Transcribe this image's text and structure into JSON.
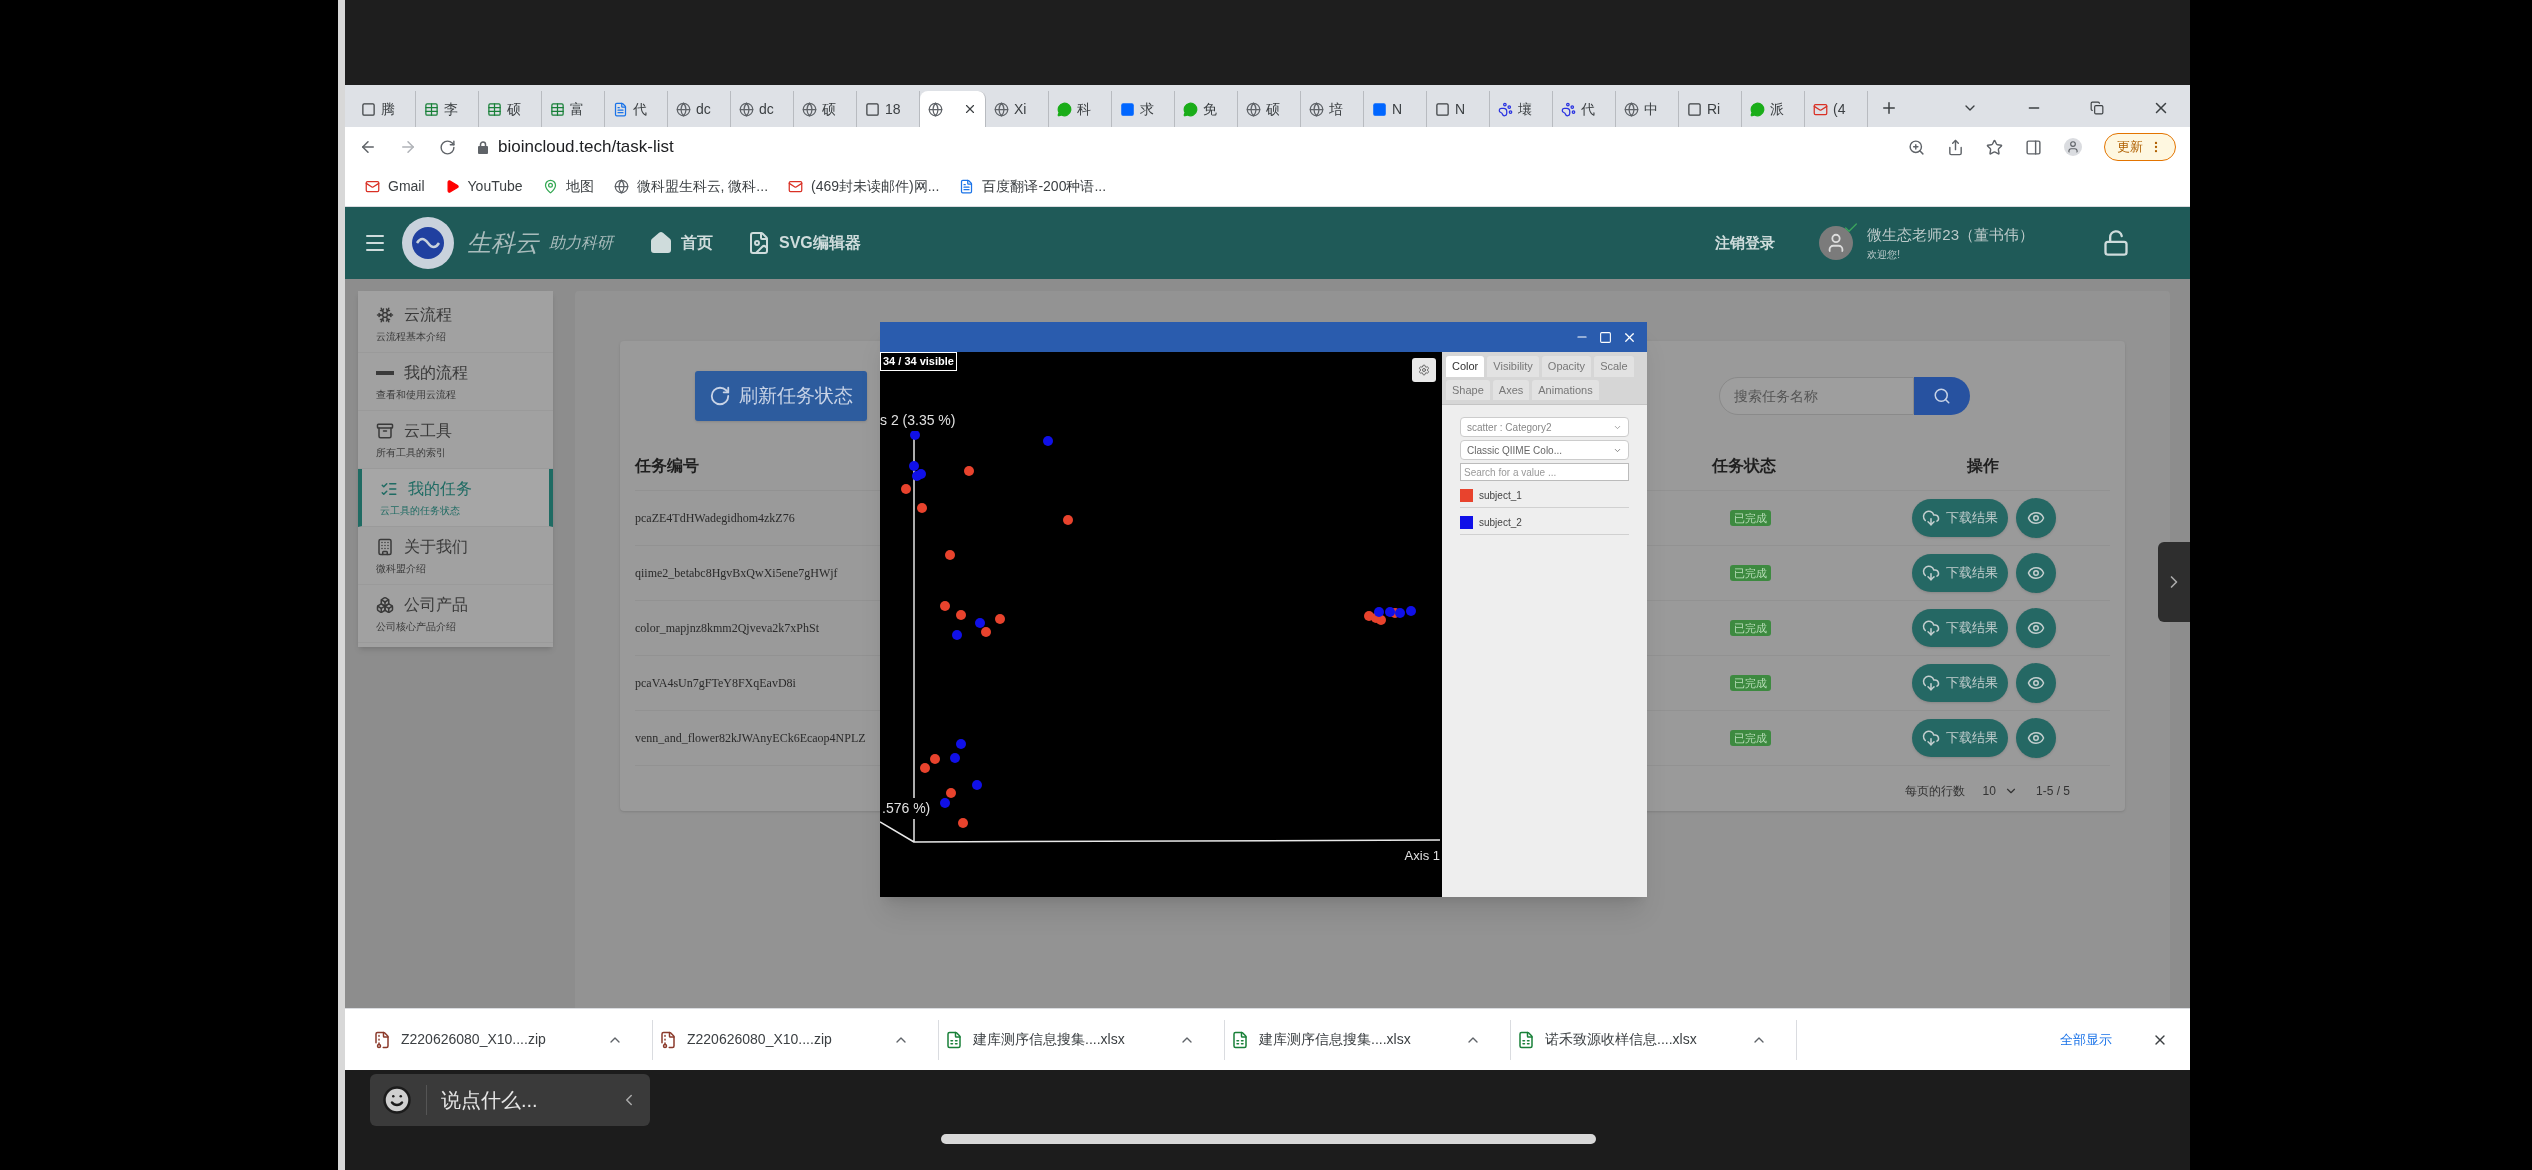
{
  "browser": {
    "tabs": [
      {
        "label": "腾",
        "kind": "other",
        "selected": false
      },
      {
        "label": "李",
        "kind": "sheet",
        "selected": false
      },
      {
        "label": "硕",
        "kind": "sheet",
        "selected": false
      },
      {
        "label": "富",
        "kind": "sheet",
        "selected": false
      },
      {
        "label": "代",
        "kind": "doc",
        "selected": false
      },
      {
        "label": "dc",
        "kind": "globe",
        "selected": false
      },
      {
        "label": "dc",
        "kind": "globe",
        "selected": false
      },
      {
        "label": "硕",
        "kind": "globe",
        "selected": false
      },
      {
        "label": "18",
        "kind": "other",
        "selected": false
      },
      {
        "kind": "globe",
        "selected": true
      },
      {
        "label": "Xi",
        "kind": "globe",
        "selected": false
      },
      {
        "label": "科",
        "kind": "chat",
        "selected": false
      },
      {
        "label": "求",
        "kind": "zhihu",
        "selected": false
      },
      {
        "label": "免",
        "kind": "chat",
        "selected": false
      },
      {
        "label": "硕",
        "kind": "globe",
        "selected": false
      },
      {
        "label": "培",
        "kind": "globe",
        "selected": false
      },
      {
        "label": "N",
        "kind": "zhihu",
        "selected": false
      },
      {
        "label": "N",
        "kind": "other",
        "selected": false
      },
      {
        "label": "壤",
        "kind": "paw",
        "selected": false
      },
      {
        "label": "代",
        "kind": "paw",
        "selected": false
      },
      {
        "label": "中",
        "kind": "globe",
        "selected": false
      },
      {
        "label": "Ri",
        "kind": "other",
        "selected": false
      },
      {
        "label": "派",
        "kind": "chat",
        "selected": false
      },
      {
        "label": "(4",
        "kind": "mail",
        "selected": false
      }
    ],
    "url": "bioincloud.tech/task-list",
    "update_button": "更新",
    "bookmarks": [
      {
        "label": "Gmail",
        "kind": "mail"
      },
      {
        "label": "YouTube",
        "kind": "video"
      },
      {
        "label": "地图",
        "kind": "map"
      },
      {
        "label": "微科盟生科云, 微科...",
        "kind": "globe"
      },
      {
        "label": "(469封未读邮件)网...",
        "kind": "mail"
      },
      {
        "label": "百度翻译-200种语...",
        "kind": "doc"
      }
    ]
  },
  "site": {
    "brand": "生科云",
    "slogan": "助力科研",
    "nav": [
      "首页",
      "SVG编辑器"
    ],
    "logout": "注销登录",
    "user_name": "微生态老师23（董书伟）",
    "user_greeting": "欢迎您!"
  },
  "sidebar": [
    {
      "title": "云流程",
      "subtitle": "云流程基本介绍",
      "selected": false
    },
    {
      "title": "我的流程",
      "subtitle": "查看和使用云流程",
      "selected": false
    },
    {
      "title": "云工具",
      "subtitle": "所有工具的索引",
      "selected": false
    },
    {
      "title": "我的任务",
      "subtitle": "云工具的任务状态",
      "selected": true
    },
    {
      "title": "关于我们",
      "subtitle": "微科盟介绍",
      "selected": false
    },
    {
      "title": "公司产品",
      "subtitle": "公司核心产品介绍",
      "selected": false
    }
  ],
  "refresh_button": "刷新任务状态",
  "search": {
    "placeholder": "搜索任务名称"
  },
  "table": {
    "columns": [
      "任务编号",
      "任务状态",
      "操作"
    ],
    "rows": [
      {
        "id": "pcaZE4TdHWadegidhom4zkZ76",
        "status": "已完成",
        "action": "下载结果"
      },
      {
        "id": "qiime2_betabc8HgvBxQwXi5ene7gHWjf",
        "status": "已完成",
        "action": "下载结果"
      },
      {
        "id": "color_mapjnz8kmm2Qjveva2k7xPhSt",
        "status": "已完成",
        "action": "下载结果"
      },
      {
        "id": "pcaVA4sUn7gFTeY8FXqEavD8i",
        "status": "已完成",
        "action": "下载结果"
      },
      {
        "id": "venn_and_flower82kJWAnyECk6Ecaop4NPLZ",
        "status": "已完成",
        "action": "下载结果"
      }
    ]
  },
  "pagination": {
    "label": "每页的行数",
    "per_page": "10",
    "range": "1-5 / 5"
  },
  "dialog": {
    "visible_count": "34 / 34 visible",
    "axis_labels": [
      "s 2 (3.35 %)",
      ".576 %)",
      "Axis 1"
    ],
    "tabs": [
      {
        "label": "Color",
        "selected": true
      },
      {
        "label": "Visibility",
        "selected": false
      },
      {
        "label": "Opacity",
        "selected": false
      },
      {
        "label": "Scale",
        "selected": false
      },
      {
        "label": "Shape",
        "selected": false
      },
      {
        "label": "Axes",
        "selected": false
      },
      {
        "label": "Animations",
        "selected": false
      }
    ],
    "color_by": "scatter : Category2",
    "colormap": "Classic QIIME Colo...",
    "search_placeholder": "Search for a value ...",
    "legend": [
      {
        "label": "subject_1",
        "color": "#e8432d"
      },
      {
        "label": "subject_2",
        "color": "#1010e8"
      }
    ]
  },
  "downloads": {
    "items": [
      {
        "name": "Z220626080_X10....zip",
        "kind": "zip"
      },
      {
        "name": "Z220626080_X10....zip",
        "kind": "zip"
      },
      {
        "name": "建库测序信息搜集....xlsx",
        "kind": "xlsx"
      },
      {
        "name": "建库测序信息搜集....xlsx",
        "kind": "xlsx"
      },
      {
        "name": "诺禾致源收样信息....xlsx",
        "kind": "xlsx"
      }
    ],
    "show_all": "全部显示"
  },
  "chat": {
    "placeholder": "说点什么..."
  }
}
